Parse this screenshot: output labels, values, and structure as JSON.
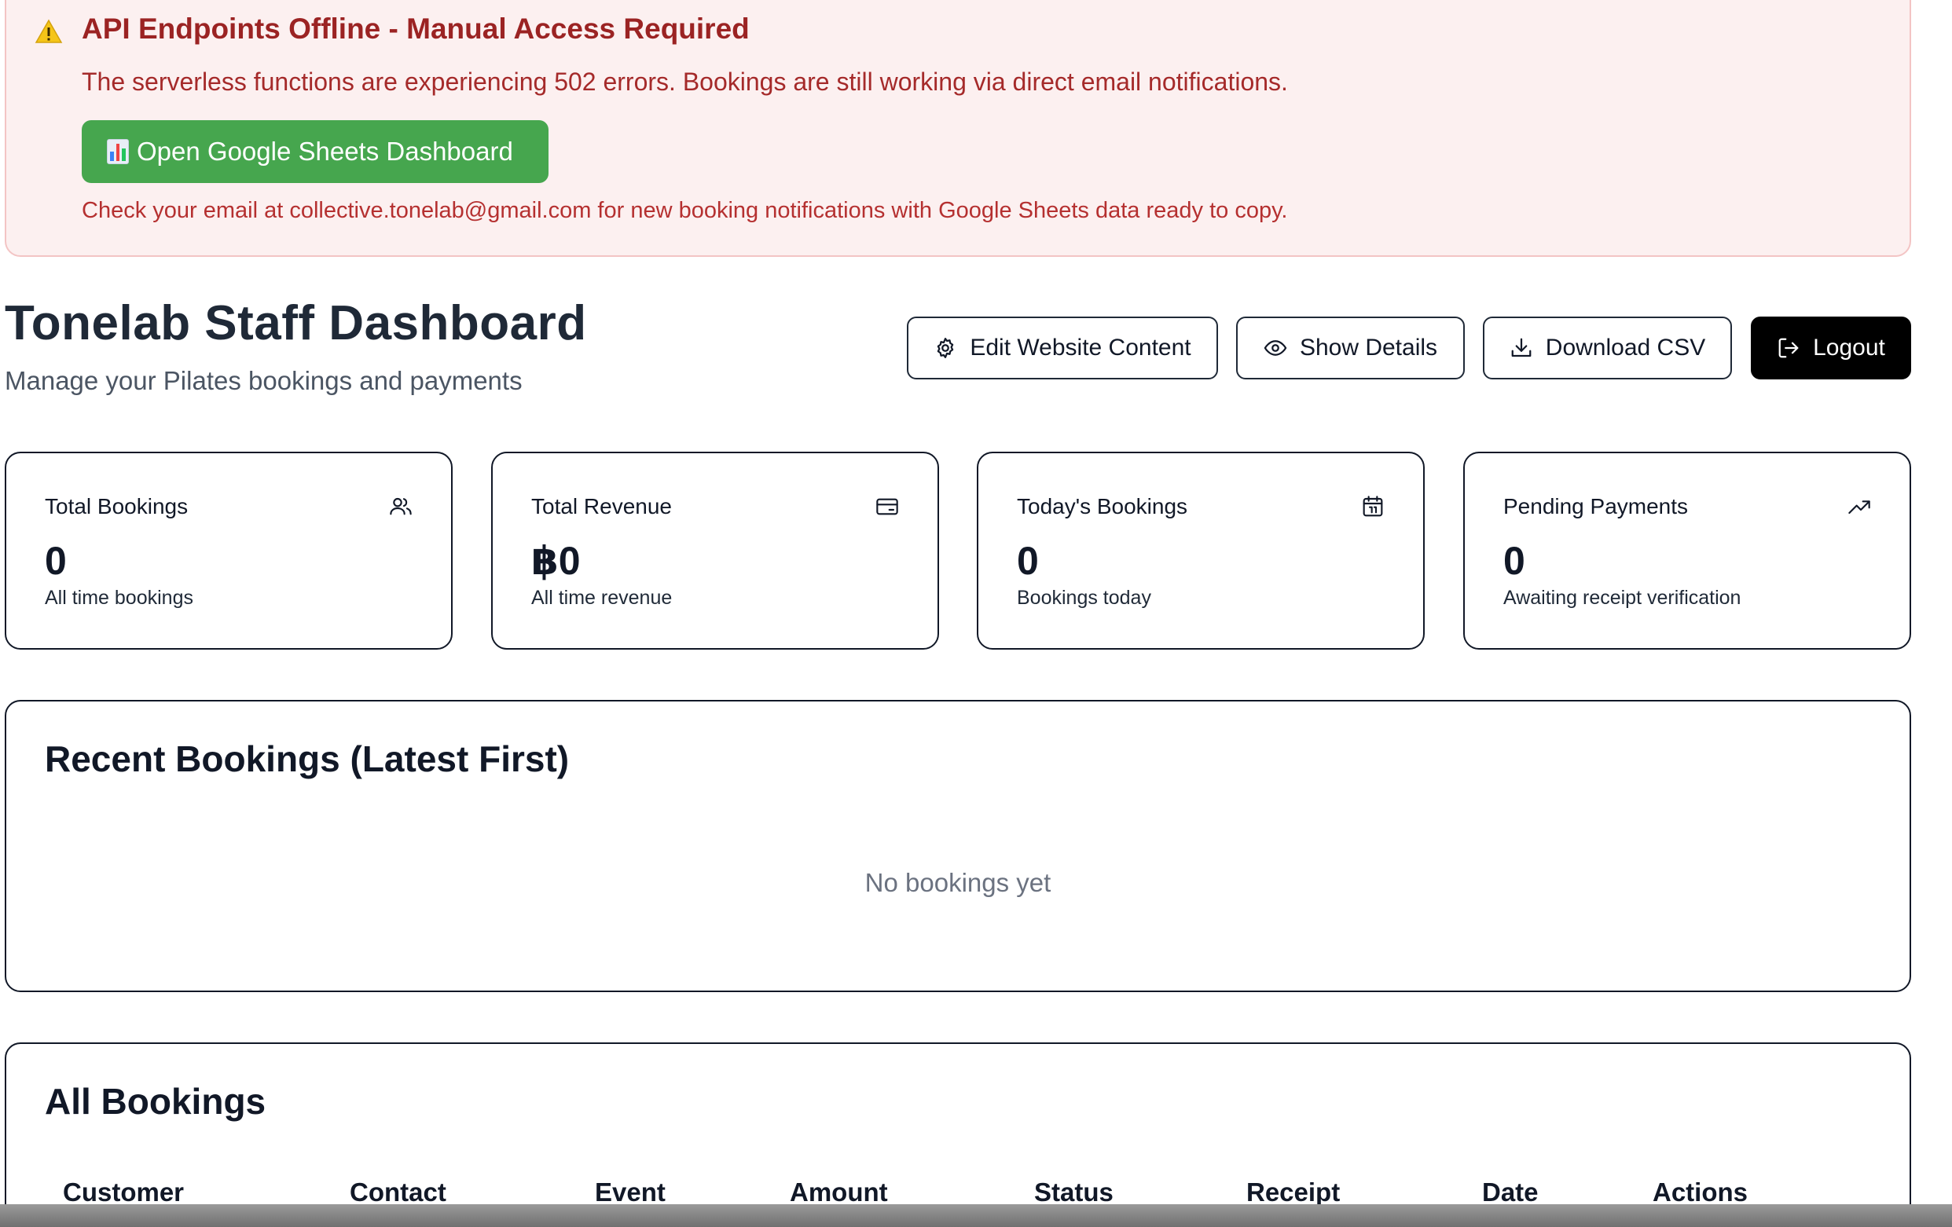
{
  "alert": {
    "title": "API Endpoints Offline - Manual Access Required",
    "message": "The serverless functions are experiencing 502 errors. Bookings are still working via direct email notifications.",
    "button_label": "Open Google Sheets Dashboard",
    "note": "Check your email at collective.tonelab@gmail.com for new booking notifications with Google Sheets data ready to copy.",
    "icon": "warning-icon"
  },
  "header": {
    "title": "Tonelab Staff Dashboard",
    "subtitle": "Manage your Pilates bookings and payments",
    "buttons": {
      "edit": "Edit Website Content",
      "details": "Show Details",
      "csv": "Download CSV",
      "logout": "Logout"
    }
  },
  "stats": [
    {
      "label": "Total Bookings",
      "value": "0",
      "sub": "All time bookings",
      "icon": "users-icon"
    },
    {
      "label": "Total Revenue",
      "value": "฿0",
      "sub": "All time revenue",
      "icon": "credit-card-icon"
    },
    {
      "label": "Today's Bookings",
      "value": "0",
      "sub": "Bookings today",
      "icon": "calendar-icon"
    },
    {
      "label": "Pending Payments",
      "value": "0",
      "sub": "Awaiting receipt verification",
      "icon": "trending-up-icon"
    }
  ],
  "recent": {
    "title": "Recent Bookings (Latest First)",
    "empty_text": "No bookings yet"
  },
  "all_bookings": {
    "title": "All Bookings",
    "columns": [
      "Customer",
      "Contact",
      "Event",
      "Amount",
      "Status",
      "Receipt",
      "Date",
      "Actions"
    ]
  },
  "colors": {
    "alert_bg": "#fcf0f0",
    "alert_text": "#9b2323",
    "sheets_button": "#46a64e",
    "logout_button": "#000000"
  }
}
